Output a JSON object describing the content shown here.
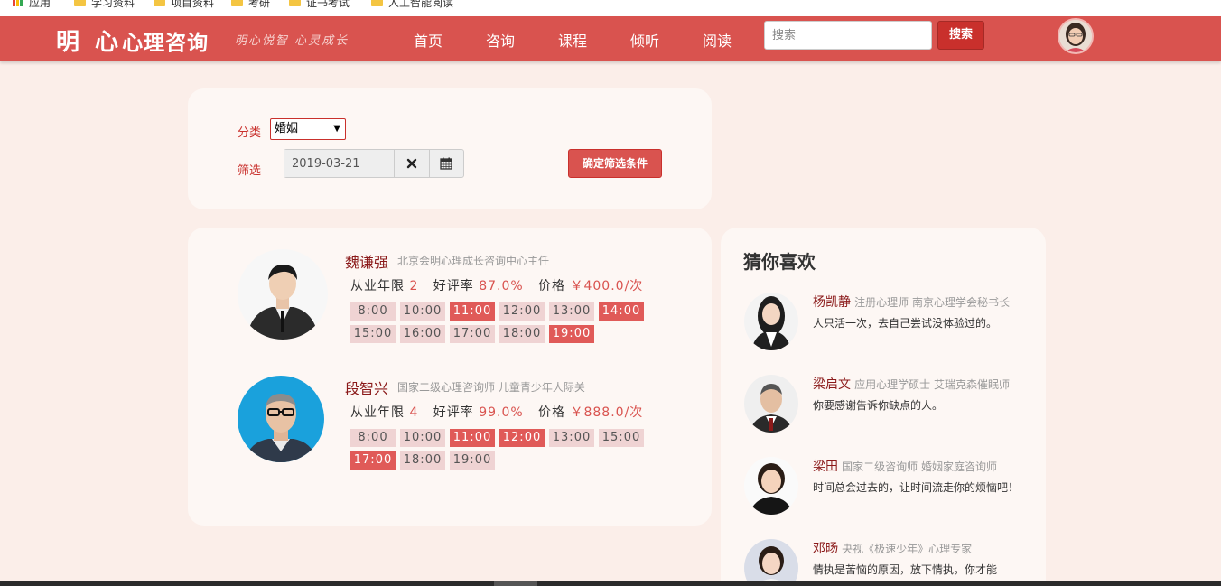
{
  "bookmarks": [
    "应用",
    "学习资料",
    "项目资料",
    "考研",
    "证书考试",
    "人工智能阅读"
  ],
  "brand": {
    "logo_big": "明 心",
    "logo_rest": "心理咨询",
    "slogan": "明心悦智 心灵成长"
  },
  "nav": {
    "links": [
      "首页",
      "咨询",
      "课程",
      "倾听",
      "阅读"
    ],
    "search_placeholder": "搜索",
    "search_button": "搜索"
  },
  "filter": {
    "category_label": "分类",
    "category_value": "婚姻",
    "date_label": "筛选",
    "date_value": "2019-03-21",
    "confirm_button": "确定筛选条件"
  },
  "counselors": [
    {
      "name": "魏谦强",
      "title": "北京会明心理成长咨询中心主任",
      "years_label": "从业年限",
      "years": "2",
      "rating_label": "好评率",
      "rating": "87.0%",
      "price_label": "价格",
      "price": "￥400.0/次",
      "slots": [
        {
          "time": "8:00",
          "busy": false
        },
        {
          "time": "10:00",
          "busy": false
        },
        {
          "time": "11:00",
          "busy": true
        },
        {
          "time": "12:00",
          "busy": false
        },
        {
          "time": "13:00",
          "busy": false
        },
        {
          "time": "14:00",
          "busy": true
        },
        {
          "time": "15:00",
          "busy": false
        },
        {
          "time": "16:00",
          "busy": false
        },
        {
          "time": "17:00",
          "busy": false
        },
        {
          "time": "18:00",
          "busy": false
        },
        {
          "time": "19:00",
          "busy": true
        }
      ]
    },
    {
      "name": "段智兴",
      "title": "国家二级心理咨询师 儿童青少年人际关",
      "years_label": "从业年限",
      "years": "4",
      "rating_label": "好评率",
      "rating": "99.0%",
      "price_label": "价格",
      "price": "￥888.0/次",
      "slots": [
        {
          "time": "8:00",
          "busy": false
        },
        {
          "time": "10:00",
          "busy": false
        },
        {
          "time": "11:00",
          "busy": true
        },
        {
          "time": "12:00",
          "busy": true
        },
        {
          "time": "13:00",
          "busy": false
        },
        {
          "time": "15:00",
          "busy": false
        },
        {
          "time": "17:00",
          "busy": true
        },
        {
          "time": "18:00",
          "busy": false
        },
        {
          "time": "19:00",
          "busy": false
        }
      ]
    }
  ],
  "recommend": {
    "title": "猜你喜欢",
    "items": [
      {
        "name": "杨凯静",
        "tags": "注册心理师 南京心理学会秘书长",
        "quote": "人只活一次，去自己尝试没体验过的。"
      },
      {
        "name": "梁启文",
        "tags": "应用心理学硕士 艾瑞克森催眠师",
        "quote": "你要感谢告诉你缺点的人。"
      },
      {
        "name": "梁田",
        "tags": "国家二级咨询师 婚姻家庭咨询师",
        "quote": "时间总会过去的，让时间流走你的烦恼吧！"
      },
      {
        "name": "邓旸",
        "tags": "央视《极速少年》心理专家",
        "quote": "情执是苦恼的原因，放下情执，你才能"
      }
    ]
  },
  "colors": {
    "primary": "#d9534f",
    "busy_slot": "#e05a58",
    "free_slot": "#efd3d3",
    "page_bg": "#fbeee9"
  }
}
